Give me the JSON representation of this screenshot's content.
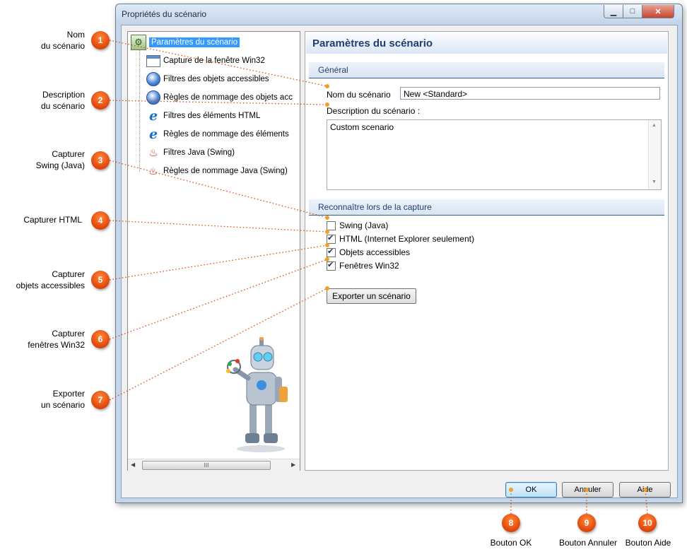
{
  "window": {
    "title": "Propriétés du scénario",
    "controls": {
      "minimize": "▁",
      "maximize": "□",
      "close": "✕"
    }
  },
  "tree": {
    "items": [
      {
        "label": "Paramètres du scénario",
        "icon": "settings-icon",
        "selected": true
      },
      {
        "label": "Capture de la fenêtre Win32",
        "icon": "window-icon"
      },
      {
        "label": "Filtres des objets accessibles",
        "icon": "accessibility-globe-icon"
      },
      {
        "label": "Règles de nommage des objets acc",
        "icon": "accessibility-globe-icon"
      },
      {
        "label": "Filtres des éléments HTML",
        "icon": "internet-explorer-icon"
      },
      {
        "label": "Règles de nommage des éléments",
        "icon": "internet-explorer-icon"
      },
      {
        "label": "Filtres Java (Swing)",
        "icon": "java-icon"
      },
      {
        "label": "Règles de nommage Java (Swing)",
        "icon": "java-icon"
      }
    ],
    "scroll_thumb": "III"
  },
  "panel": {
    "title": "Paramètres du scénario",
    "general_section": "Général",
    "name_label": "Nom du scénario",
    "name_value": "New <Standard>",
    "desc_label": "Description du scénario :",
    "desc_value": "Custom scenario",
    "recognize_section": "Reconnaître lors de la capture",
    "checkboxes": [
      {
        "label": "Swing (Java)",
        "checked": false
      },
      {
        "label": "HTML (Internet Explorer seulement)",
        "checked": true
      },
      {
        "label": "Objets accessibles",
        "checked": true
      },
      {
        "label": "Fenêtres Win32",
        "checked": true
      }
    ],
    "export_button": "Exporter un scénario"
  },
  "buttons": {
    "ok": "OK",
    "cancel": "Annuler",
    "help": "Aide"
  },
  "callouts": [
    {
      "num": "1",
      "label_lines": [
        "Nom",
        "du scénario"
      ]
    },
    {
      "num": "2",
      "label_lines": [
        "Description",
        "du scénario"
      ]
    },
    {
      "num": "3",
      "label_lines": [
        "Capturer",
        "Swing (Java)"
      ]
    },
    {
      "num": "4",
      "label_lines": [
        "Capturer HTML"
      ]
    },
    {
      "num": "5",
      "label_lines": [
        "Capturer",
        "objets accessibles"
      ]
    },
    {
      "num": "6",
      "label_lines": [
        "Capturer",
        "fenêtres Win32"
      ]
    },
    {
      "num": "7",
      "label_lines": [
        "Exporter",
        "un scénario"
      ]
    },
    {
      "num": "8",
      "label_lines": [
        "Bouton OK"
      ]
    },
    {
      "num": "9",
      "label_lines": [
        "Bouton Annuler"
      ]
    },
    {
      "num": "10",
      "label_lines": [
        "Bouton Aide"
      ]
    }
  ],
  "colors": {
    "callout": "#e2480c",
    "connector": "#e2480c",
    "selection": "#3399ff",
    "header_text": "#1e3f73"
  }
}
